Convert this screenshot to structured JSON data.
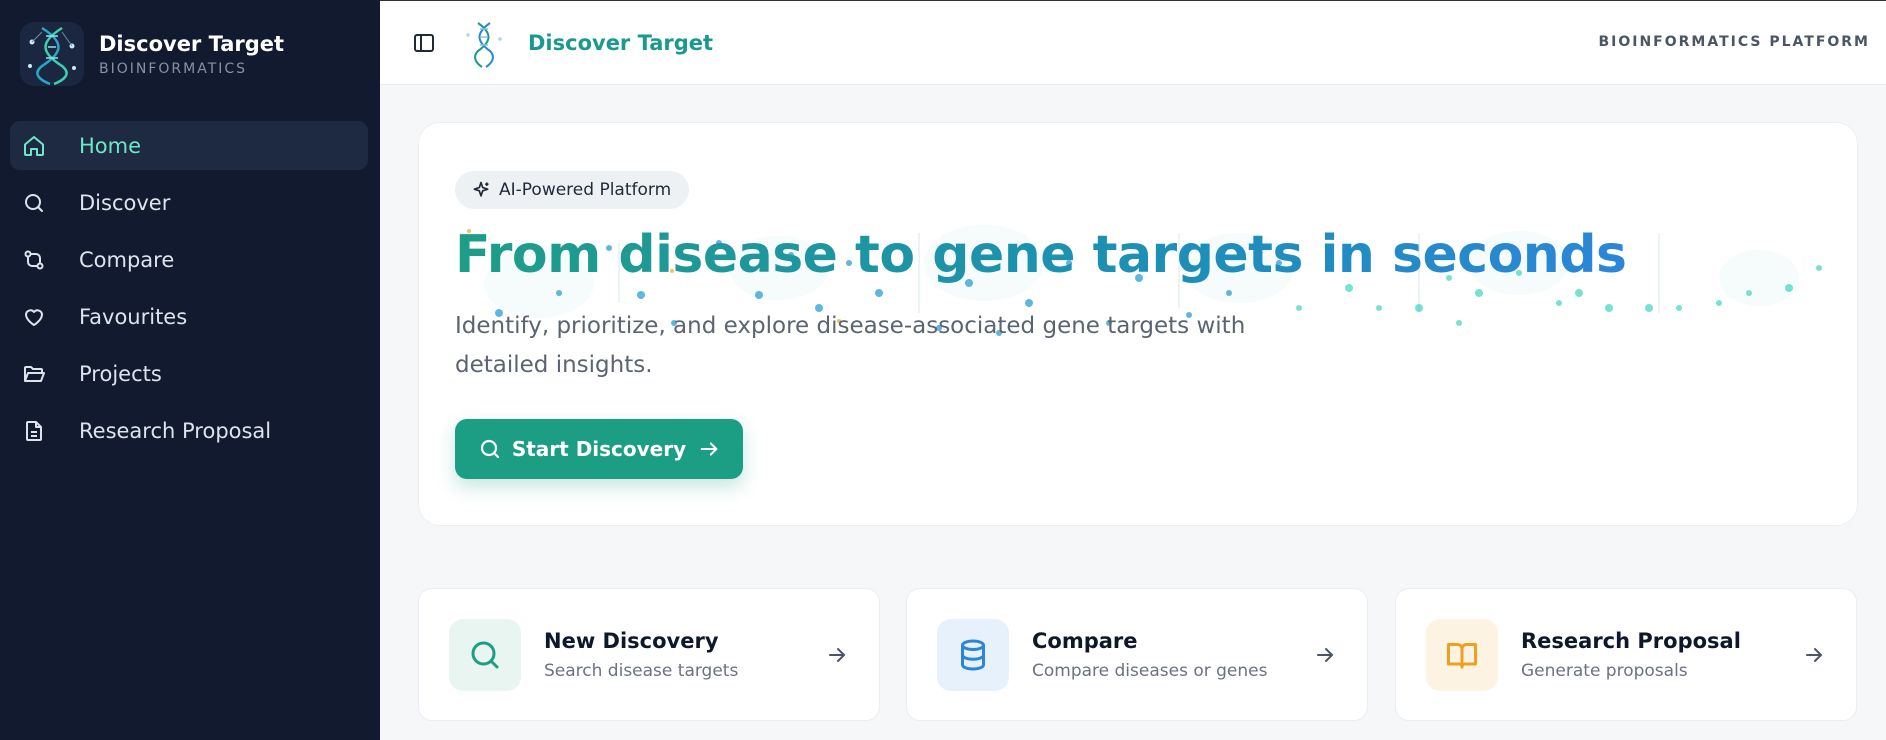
{
  "sidebar": {
    "brand_title": "Discover Target",
    "brand_subtitle": "BIOINFORMATICS",
    "items": [
      {
        "label": "Home",
        "icon": "home-icon",
        "active": true
      },
      {
        "label": "Discover",
        "icon": "search-icon"
      },
      {
        "label": "Compare",
        "icon": "git-compare-icon"
      },
      {
        "label": "Favourites",
        "icon": "heart-icon"
      },
      {
        "label": "Projects",
        "icon": "folder-open-icon"
      },
      {
        "label": "Research Proposal",
        "icon": "file-text-icon"
      }
    ]
  },
  "header": {
    "title": "Discover Target",
    "right_label": "BIOINFORMATICS PLATFORM"
  },
  "hero": {
    "badge": "AI-Powered Platform",
    "title": "From disease to gene targets in seconds",
    "description": "Identify, prioritize, and explore disease-associated gene targets with detailed insights.",
    "cta": "Start Discovery"
  },
  "cards": [
    {
      "title": "New Discovery",
      "subtitle": "Search disease targets",
      "icon": "search-icon",
      "color": "#1c9e85"
    },
    {
      "title": "Compare",
      "subtitle": "Compare diseases or genes",
      "icon": "database-icon",
      "color": "#2b86d8"
    },
    {
      "title": "Research Proposal",
      "subtitle": "Generate proposals",
      "icon": "book-open-icon",
      "color": "#f0a020"
    }
  ],
  "colors": {
    "sidebar_bg": "#111a2e",
    "accent": "#1c9e85",
    "active_text": "#6ee7c8"
  }
}
